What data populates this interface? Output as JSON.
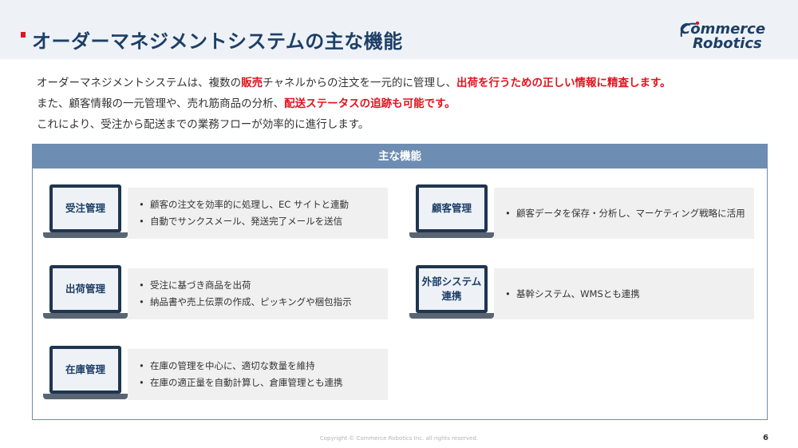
{
  "header": {
    "title": "オーダーマネジメントシステムの主な機能",
    "logo_line1": "Commerce",
    "logo_line2": "Robotics"
  },
  "intro": {
    "line1": [
      {
        "text": "オーダーマネジメントシステムは、複数の",
        "highlight": false
      },
      {
        "text": "販売",
        "highlight": true
      },
      {
        "text": "チャネルからの注文を一元的に管理し、",
        "highlight": false
      },
      {
        "text": "出荷を行うための正しい情報に精査します。",
        "highlight": true
      }
    ],
    "line2": [
      {
        "text": "また、顧客情報の一元管理や、売れ筋商品の分析、",
        "highlight": false
      },
      {
        "text": "配送ステータスの追跡も可能です。",
        "highlight": true
      }
    ],
    "line3": [
      {
        "text": "これにより、受注から配送までの業務フローが効率的に進行します。",
        "highlight": false
      }
    ]
  },
  "panel": {
    "heading": "主な機能",
    "features": [
      {
        "label": "受注管理",
        "items": [
          "顧客の注文を効率的に処理し、EC サイトと連動",
          "自動でサンクスメール、発送完了メールを送信"
        ]
      },
      {
        "label": "顧客管理",
        "items": [
          "顧客データを保存・分析し、マーケティング戦略に活用"
        ]
      },
      {
        "label": "出荷管理",
        "items": [
          "受注に基づき商品を出荷",
          "納品書や売上伝票の作成、ピッキングや梱包指示"
        ]
      },
      {
        "label": "外部システム連携",
        "items": [
          "基幹システム、WMSとも連携"
        ]
      },
      {
        "label": "在庫管理",
        "items": [
          "在庫の管理を中心に、適切な数量を維持",
          "在庫の適正量を自動計算し、倉庫管理とも連携"
        ]
      }
    ]
  },
  "footer": {
    "copyright": "Copyright © Commerce Robotics Inc. all rights reserved.",
    "page_number": "6"
  },
  "colors": {
    "title": "#1d3f66",
    "accent_red": "#e0141e",
    "panel_blue": "#6d8db3"
  }
}
